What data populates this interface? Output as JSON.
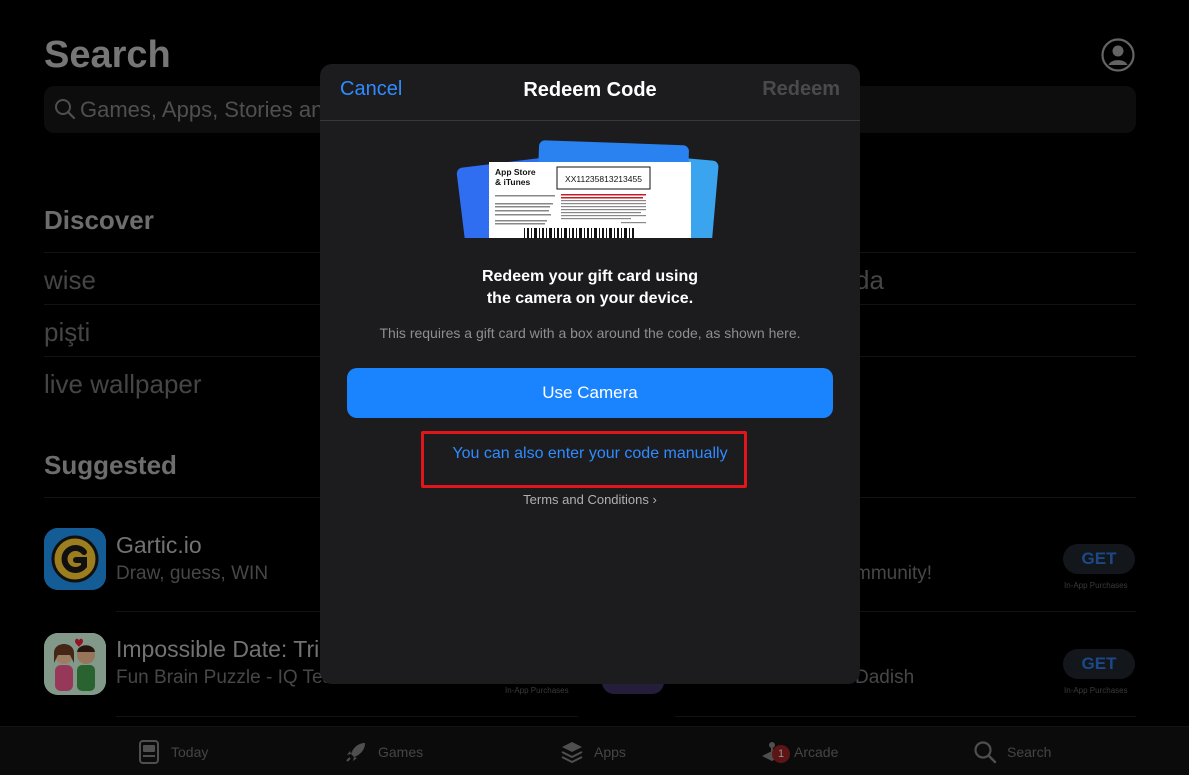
{
  "page": {
    "title": "Search",
    "search_placeholder": "Games, Apps, Stories and More"
  },
  "discover": {
    "title": "Discover",
    "items": [
      "wise",
      "pişti",
      "live wallpaper"
    ],
    "right_items": [
      "da"
    ]
  },
  "suggested": {
    "title": "Suggested",
    "apps": [
      {
        "name": "Gartic.io",
        "subtitle": "Draw, guess, WIN",
        "right_subtitle": "mmunity!",
        "get": "GET",
        "iap": "In-App Purchases"
      },
      {
        "name": "Impossible Date: Tric",
        "subtitle": "Fun Brain Puzzle - IQ Tes",
        "right_subtitle": "Dadish",
        "get": "GET",
        "iap": "In-App Purchases",
        "left_iap": "In-App Purchases"
      }
    ]
  },
  "modal": {
    "cancel": "Cancel",
    "title": "Redeem Code",
    "redeem": "Redeem",
    "card": {
      "brand_line1": "App Store",
      "brand_line2": "& iTunes",
      "code": "XX11235813213455"
    },
    "headline_line1": "Redeem your gift card using",
    "headline_line2": "the camera on your device.",
    "subtext": "This requires a gift card with a box around the code, as shown here.",
    "camera_button": "Use Camera",
    "manual_link": "You can also enter your code manually",
    "terms": "Terms and Conditions ›"
  },
  "tabbar": {
    "tabs": [
      {
        "label": "Today",
        "icon": "today-icon"
      },
      {
        "label": "Games",
        "icon": "rocket-icon"
      },
      {
        "label": "Apps",
        "icon": "stack-icon"
      },
      {
        "label": "Arcade",
        "icon": "arcade-icon",
        "badge": "1"
      },
      {
        "label": "Search",
        "icon": "search-icon"
      }
    ]
  },
  "colors": {
    "accent": "#1a84ff",
    "link": "#2f8bff",
    "highlight_box": "#e0161b",
    "modal_bg": "#1c1c1e"
  }
}
